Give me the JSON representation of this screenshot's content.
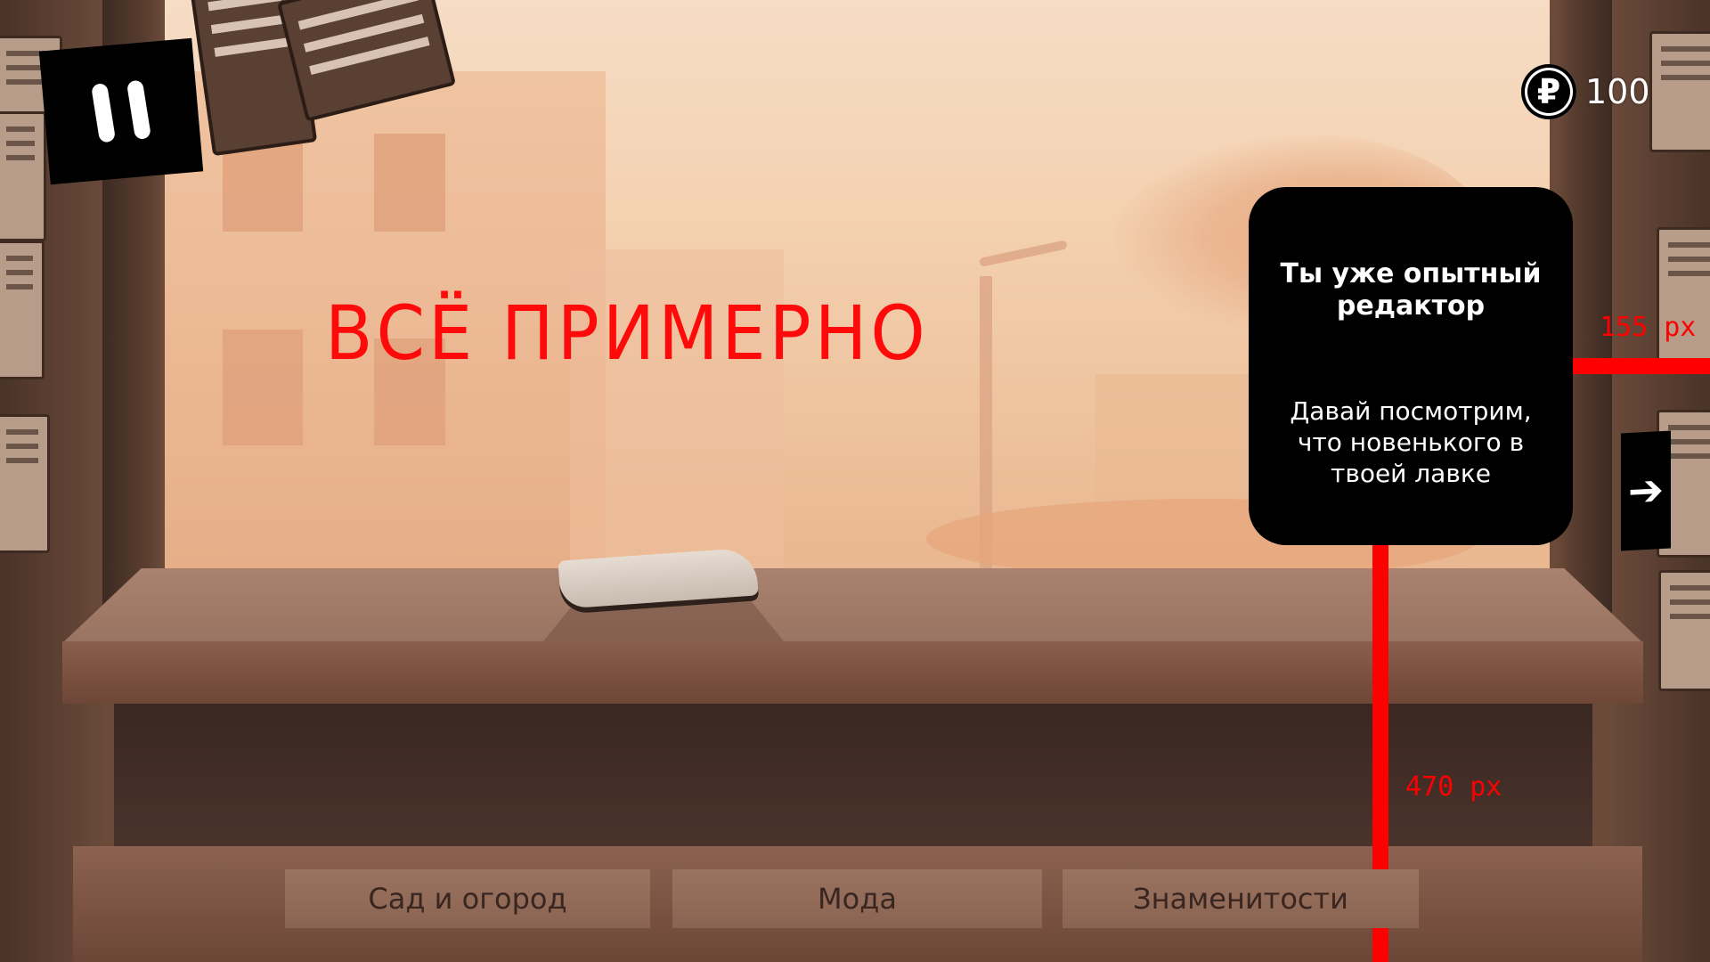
{
  "hud": {
    "currency_symbol": "₽",
    "currency_amount": "100"
  },
  "main": {
    "rating_text": "ВСЁ ПРИМЕРНО"
  },
  "dialog": {
    "title": "Ты уже опытный редактор",
    "body": "Давай посмотрим, что новенького в твоей лавке",
    "next_icon": "arrow-right-icon"
  },
  "guides": {
    "horizontal_label": "155 px",
    "vertical_label": "470 px"
  },
  "categories": [
    {
      "label": "Сад и огород"
    },
    {
      "label": "Мода"
    },
    {
      "label": "Знаменитости"
    }
  ],
  "colors": {
    "accent_red": "#ff0a0a",
    "panel_black": "#000000",
    "tab_fill": "#8a6452"
  }
}
